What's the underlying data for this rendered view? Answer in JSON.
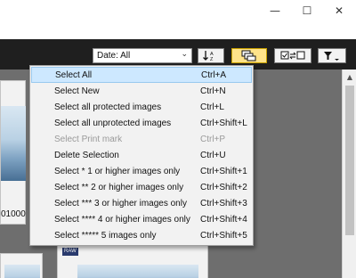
{
  "window": {
    "minimize_icon": "minimize-icon",
    "maximize_icon": "maximize-icon",
    "close_icon": "close-icon"
  },
  "toolbar": {
    "date_filter": "Date: All",
    "buttons": [
      {
        "name": "sort-button",
        "icon": "sort-az-icon"
      },
      {
        "name": "group-button",
        "icon": "group-icon"
      },
      {
        "name": "compare-button",
        "icon": "compare-icon"
      },
      {
        "name": "filter-button",
        "icon": "filter-icon"
      }
    ]
  },
  "content": {
    "thumb_caption": "01000",
    "badge": "RAW"
  },
  "menu": {
    "items": [
      {
        "label": "Select All",
        "shortcut": "Ctrl+A",
        "highlighted": true,
        "disabled": false
      },
      {
        "label": "Select New",
        "shortcut": "Ctrl+N",
        "highlighted": false,
        "disabled": false
      },
      {
        "label": "Select all protected images",
        "shortcut": "Ctrl+L",
        "highlighted": false,
        "disabled": false
      },
      {
        "label": "Select all unprotected images",
        "shortcut": "Ctrl+Shift+L",
        "highlighted": false,
        "disabled": false
      },
      {
        "label": "Select Print mark",
        "shortcut": "Ctrl+P",
        "highlighted": false,
        "disabled": true
      },
      {
        "label": "Delete Selection",
        "shortcut": "Ctrl+U",
        "highlighted": false,
        "disabled": false
      },
      {
        "label": "Select * 1 or higher images only",
        "shortcut": "Ctrl+Shift+1",
        "highlighted": false,
        "disabled": false
      },
      {
        "label": "Select ** 2 or higher images only",
        "shortcut": "Ctrl+Shift+2",
        "highlighted": false,
        "disabled": false
      },
      {
        "label": "Select *** 3 or higher images only",
        "shortcut": "Ctrl+Shift+3",
        "highlighted": false,
        "disabled": false
      },
      {
        "label": "Select **** 4 or higher images only",
        "shortcut": "Ctrl+Shift+4",
        "highlighted": false,
        "disabled": false
      },
      {
        "label": "Select ***** 5 images only",
        "shortcut": "Ctrl+Shift+5",
        "highlighted": false,
        "disabled": false
      }
    ]
  },
  "colors": {
    "toolbar_bg": "#1f1f1f",
    "content_bg": "#6e6e6e",
    "menu_highlight": "#cde8ff",
    "active_toggle": "#ffe38a"
  }
}
